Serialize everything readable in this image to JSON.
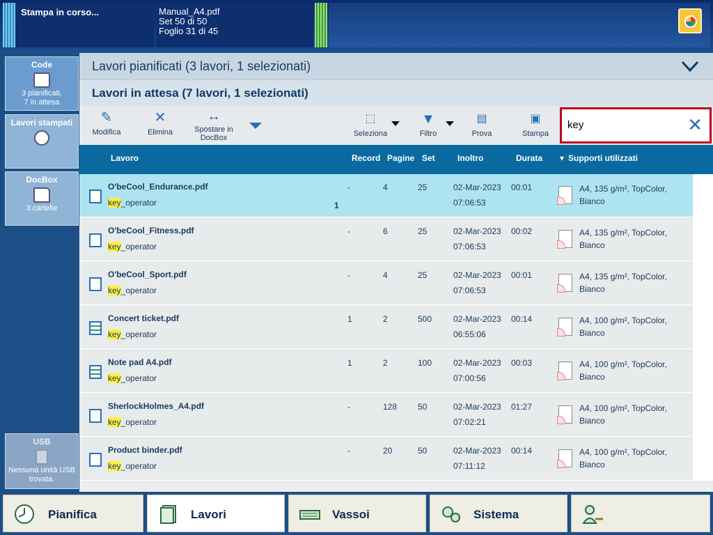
{
  "top": {
    "status": "Stampa in corso...",
    "job_name": "Manual_A4.pdf",
    "set_progress": "Set 50 di 50",
    "sheet_progress": "Foglio 31 di 45"
  },
  "nav": {
    "code": {
      "title": "Code",
      "line1": "3 pianificati,",
      "line2": "7 in attesa"
    },
    "printed": {
      "title": "Lavori stampati"
    },
    "docbox": {
      "title": "DocBox",
      "sub": "3 cartelle"
    },
    "usb": {
      "title": "USB",
      "line1": "Nessuna unità USB",
      "line2": "trovata."
    }
  },
  "headers": {
    "planned": "Lavori pianificati (3 lavori, 1 selezionati)",
    "waiting": "Lavori in attesa (7 lavori, 1 selezionati)"
  },
  "toolbar": {
    "edit": "Modifica",
    "delete": "Elimina",
    "move_line1": "Spostare in",
    "move_line2": "DocBox",
    "select": "Seleziona",
    "filter": "Filtro",
    "proof": "Prova",
    "print": "Stampa"
  },
  "search": {
    "value": "key"
  },
  "columns": {
    "job": "Lavoro",
    "record": "Record",
    "pages": "Pagine",
    "set": "Set",
    "submit": "Inoltro",
    "duration": "Durata",
    "media": "Supporti utilizzati"
  },
  "jobs": [
    {
      "name": "O'beCool_Endurance.pdf",
      "owner_hl": "key",
      "owner_rest": "_operator",
      "badge": "1",
      "record": "-",
      "pages": "4",
      "set": "25",
      "date": "02-Mar-2023",
      "time": "07:06:53",
      "duration": "00:01",
      "media1": "A4, 135 g/m², TopColor,",
      "media2": "Bianco"
    },
    {
      "name": "O'beCool_Fitness.pdf",
      "owner_hl": "key",
      "owner_rest": "_operator",
      "record": "-",
      "pages": "6",
      "set": "25",
      "date": "02-Mar-2023",
      "time": "07:06:53",
      "duration": "00:02",
      "media1": "A4, 135 g/m², TopColor,",
      "media2": "Bianco"
    },
    {
      "name": "O'beCool_Sport.pdf",
      "owner_hl": "key",
      "owner_rest": "_operator",
      "record": "-",
      "pages": "4",
      "set": "25",
      "date": "02-Mar-2023",
      "time": "07:06:53",
      "duration": "00:01",
      "media1": "A4, 135 g/m², TopColor,",
      "media2": "Bianco"
    },
    {
      "name": "Concert ticket.pdf",
      "owner_hl": "key",
      "owner_rest": "_operator",
      "record": "1",
      "pages": "2",
      "set": "500",
      "date": "02-Mar-2023",
      "time": "06:55:06",
      "duration": "00:14",
      "media1": "A4, 100 g/m², TopColor,",
      "media2": "Bianco"
    },
    {
      "name": "Note pad A4.pdf",
      "owner_hl": "key",
      "owner_rest": "_operator",
      "record": "1",
      "pages": "2",
      "set": "100",
      "date": "02-Mar-2023",
      "time": "07:00:56",
      "duration": "00:03",
      "media1": "A4, 100 g/m², TopColor,",
      "media2": "Bianco"
    },
    {
      "name": "SherlockHolmes_A4.pdf",
      "owner_hl": "key",
      "owner_rest": "_operator",
      "record": "-",
      "pages": "128",
      "set": "50",
      "date": "02-Mar-2023",
      "time": "07:02:21",
      "duration": "01:27",
      "media1": "A4, 100 g/m², TopColor,",
      "media2": "Bianco"
    },
    {
      "name": "Product binder.pdf",
      "owner_hl": "key",
      "owner_rest": "_operator",
      "record": "-",
      "pages": "20",
      "set": "50",
      "date": "02-Mar-2023",
      "time": "07:11:12",
      "duration": "00:14",
      "media1": "A4, 100 g/m², TopColor,",
      "media2": "Bianco"
    }
  ],
  "tabs": {
    "plan": "Pianifica",
    "jobs": "Lavori",
    "trays": "Vassoi",
    "system": "Sistema"
  },
  "colors": {
    "accent": "#0a6aa0",
    "selected_row": "#aee4f0",
    "highlight": "#ffef40",
    "search_border": "#c00018"
  }
}
